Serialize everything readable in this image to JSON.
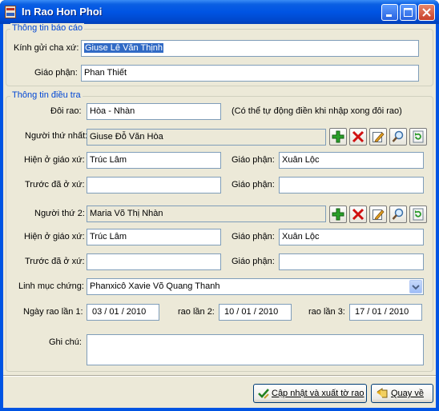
{
  "window": {
    "title": "In Rao Hon Phoi"
  },
  "report_group": {
    "legend": "Thông tin báo cáo",
    "kinh_gui_label": "Kính gửi cha xứ:",
    "kinh_gui_value": "Giuse Lê Văn Thịnh",
    "giao_phan_label": "Giáo phận:",
    "giao_phan_value": "Phan Thiết"
  },
  "survey_group": {
    "legend": "Thông tin điều tra",
    "doi_rao_label": "Đôi rao:",
    "doi_rao_value": "Hòa - Nhàn",
    "doi_rao_hint": "(Có thể tự động điền khi nhập xong đôi rao)",
    "person1": {
      "label": "Người thứ nhất:",
      "name": "Giuse Đỗ Văn Hòa",
      "current_parish_label": "Hiện ở giáo xứ:",
      "current_parish": "Trúc Lâm",
      "diocese_label": "Giáo phận:",
      "diocese": "Xuân Lộc",
      "previous_parish_label": "Trước đã ở xứ:",
      "previous_parish": "",
      "prev_diocese_label": "Giáo phận:",
      "prev_diocese": ""
    },
    "person2": {
      "label": "Người thứ 2:",
      "name": "Maria Võ Thị Nhàn",
      "current_parish_label": "Hiện ở giáo xứ:",
      "current_parish": "Trúc Lâm",
      "diocese_label": "Giáo phận:",
      "diocese": "Xuân Lộc",
      "previous_parish_label": "Trước đã ở xứ:",
      "previous_parish": "",
      "prev_diocese_label": "Giáo phận:",
      "prev_diocese": ""
    },
    "witness_label": "Linh mục chứng:",
    "witness_value": "Phanxicô Xavie Võ Quang Thanh",
    "date1_label": "Ngày rao lần 1:",
    "date1": "03 / 01 / 2010",
    "date2_label": "rao lần 2:",
    "date2": "10 / 01 / 2010",
    "date3_label": "rao lần 3:",
    "date3": "17 / 01 / 2010",
    "note_label": "Ghi chú:",
    "note_value": ""
  },
  "buttons": {
    "update_export": "Cập nhật và xuất tờ rao",
    "back": "Quay về"
  },
  "icons": [
    "app-icon",
    "minimize-icon",
    "maximize-icon",
    "close-icon",
    "add-icon",
    "delete-icon",
    "edit-icon",
    "search-icon",
    "refresh-icon",
    "check-icon",
    "back-icon"
  ]
}
